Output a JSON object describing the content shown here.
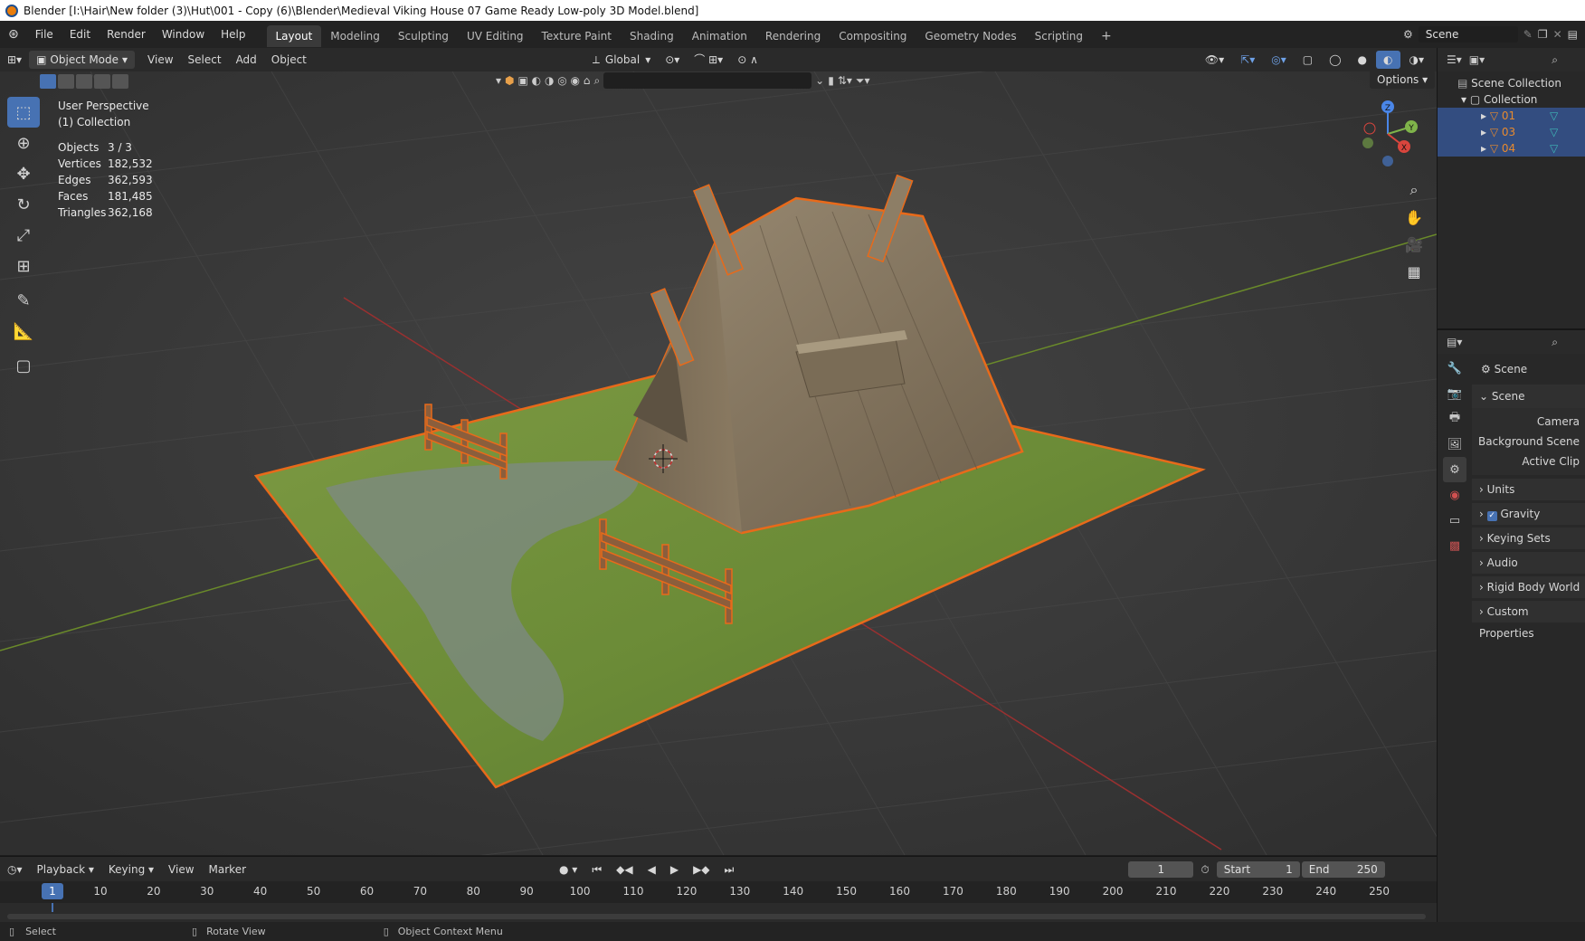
{
  "window": {
    "title": "Blender [I:\\Hair\\New folder (3)\\Hut\\001 - Copy (6)\\Blender\\Medieval Viking House 07 Game Ready Low-poly 3D Model.blend]"
  },
  "menu": [
    "File",
    "Edit",
    "Render",
    "Window",
    "Help"
  ],
  "workspaces": [
    "Layout",
    "Modeling",
    "Sculpting",
    "UV Editing",
    "Texture Paint",
    "Shading",
    "Animation",
    "Rendering",
    "Compositing",
    "Geometry Nodes",
    "Scripting"
  ],
  "active_workspace": "Layout",
  "add_workspace": "+",
  "scene_selector": "Scene",
  "header3d": {
    "mode": "Object Mode",
    "menus": [
      "View",
      "Select",
      "Add",
      "Object"
    ],
    "orientation": "Global",
    "options": "Options"
  },
  "viewport": {
    "perspective": "User Perspective",
    "collection": "(1) Collection",
    "stats": [
      {
        "k": "Objects",
        "v": "3 / 3"
      },
      {
        "k": "Vertices",
        "v": "182,532"
      },
      {
        "k": "Edges",
        "v": "362,593"
      },
      {
        "k": "Faces",
        "v": "181,485"
      },
      {
        "k": "Triangles",
        "v": "362,168"
      }
    ],
    "axis_labels": {
      "z": "Z",
      "y": "Y",
      "x": "X"
    }
  },
  "outliner": {
    "scene_collection": "Scene Collection",
    "collection": "Collection",
    "objects": [
      "01",
      "03",
      "04"
    ]
  },
  "properties": {
    "breadcrumb": "Scene",
    "panel": "Scene",
    "fields": [
      "Camera",
      "Background Scene",
      "Active Clip"
    ],
    "subpanels": [
      "Units",
      "Gravity",
      "Keying Sets",
      "Audio",
      "Rigid Body World",
      "Custom Properties"
    ],
    "gravity_checked": true
  },
  "timeline": {
    "menus": [
      "Playback",
      "Keying",
      "View",
      "Marker"
    ],
    "current_frame": "1",
    "start_label": "Start",
    "start": "1",
    "end_label": "End",
    "end": "250",
    "ticks": [
      "1",
      "10",
      "20",
      "30",
      "40",
      "50",
      "60",
      "70",
      "80",
      "90",
      "100",
      "110",
      "120",
      "130",
      "140",
      "150",
      "160",
      "170",
      "180",
      "190",
      "200",
      "210",
      "220",
      "230",
      "240",
      "250"
    ]
  },
  "statusbar": [
    "Select",
    "Rotate View",
    "Object Context Menu"
  ],
  "colors": {
    "accent": "#4772b3",
    "selection_outline": "#e86a1a",
    "grass": "#6f8f3a",
    "wood": "#8a7a62"
  }
}
